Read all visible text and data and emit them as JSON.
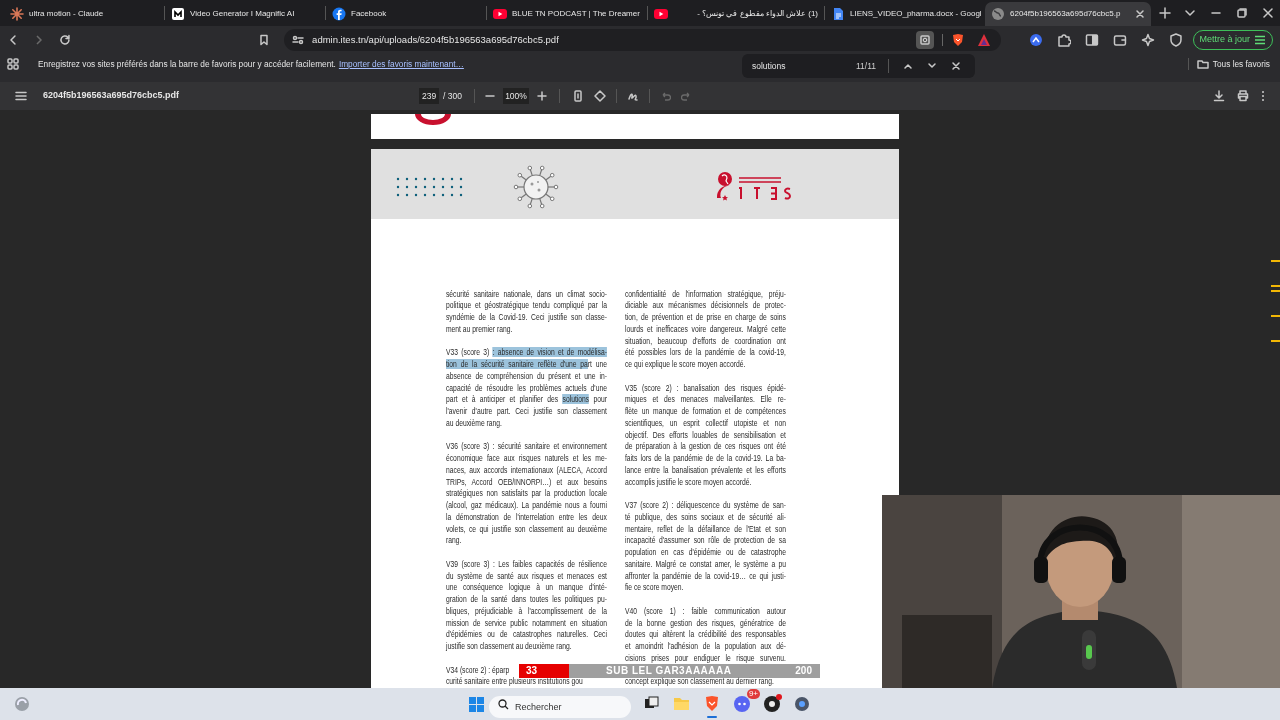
{
  "browser": {
    "tabs": [
      {
        "title": "ultra motion - Claude",
        "selected": false
      },
      {
        "title": "Video Generator I Magnific AI",
        "selected": false
      },
      {
        "title": "Facebook",
        "selected": false
      },
      {
        "title": "BLUE TN PODCAST | The Dreamer",
        "selected": false
      },
      {
        "title": "(1) علاش الدواء مقطوع في تونس؟ -",
        "selected": false
      },
      {
        "title": "LIENS_VIDEO_pharma.docx - Googl",
        "selected": false
      },
      {
        "title": "6204f5b196563a695d76cbc5.p",
        "selected": true
      }
    ],
    "address": "admin.ites.tn/api/uploads/6204f5b196563a695d76cbc5.pdf",
    "update_button": "Mettre à jour",
    "bookmarks_prompt": "Enregistrez vos sites préférés dans la barre de favoris pour y accéder facilement.",
    "bookmarks_link": "Importer des favoris maintenant…",
    "all_bookmarks": "Tous les favoris"
  },
  "find_bar": {
    "query": "solutions",
    "count": "11/11"
  },
  "pdf_viewer": {
    "filename": "6204f5b196563a695d76cbc5.pdf",
    "page": "239",
    "page_total": "/ 300",
    "zoom": "100%",
    "columns": [
      [
        [
          "sécurité sanitaire nationale, dans un climat socio-",
          "politique et géostratégique tendu compliqué par la",
          "syndémie de la Covid-19. Ceci justifie son classe-",
          "ment au premier rang."
        ],
        [
          {
            "segments": [
              {
                "text": "V33 (score 3) ",
                "highlighted": false
              },
              {
                "text": ": absence de vision et de modélisa-",
                "highlighted": true
              }
            ]
          },
          {
            "segments": [
              {
                "text": "tion de la sécurité sanitaire reflète d'une pa",
                "highlighted": true
              },
              {
                "text": "rt une",
                "highlighted": false
              }
            ]
          },
          "absence de compréhension du présent et une in-",
          "capacité de résoudre les problèmes actuels d'une",
          {
            "segments": [
              {
                "text": "part et à anticiper et planifier des ",
                "highlighted": false
              },
              {
                "text": "solutions",
                "highlighted": true
              },
              {
                "text": " pour",
                "highlighted": false
              }
            ]
          },
          "l'avenir d'autre part. Ceci justifie son classement",
          "au deuxième rang."
        ],
        [
          "V36 (score 3) : sécurité sanitaire et environnement",
          "économique face aux risques naturels et les me-",
          "naces, aux accords internationaux (ALECA, Accord",
          "TRIPs, Accord OEB/INNORPI…) et aux besoins",
          "stratégiques non satisfaits par la production locale",
          "(alcool, gaz médicaux). La pandémie nous a fourni",
          "la démonstration de l'interrelation entre les deux",
          "volets, ce qui justifie son classement au deuxième",
          "rang."
        ],
        [
          "V39 (score 3) : Les faibles capacités de résilience",
          "du système de santé aux risques et menaces est",
          "une conséquence logique à un manque d'inté-",
          "gration de la santé dans toutes les politiques pu-",
          "bliques, préjudiciable à l'accomplissement de la",
          "mission de service public notamment en situation",
          "d'épidémies ou de catastrophes naturelles. Ceci",
          "justifie son classement au deuxième rang."
        ],
        [
          "V34 (score 2) : éparp",
          "curité sanitaire entre plusieurs institutions gou"
        ]
      ],
      [
        [
          "confidentialité de l'information stratégique, préju-",
          "diciable aux mécanismes décisionnels de protec-",
          "tion, de prévention et de prise en charge de soins",
          "lourds et inefficaces voire dangereux. Malgré cette",
          "situation, beaucoup d'efforts de coordination ont",
          "été possibles lors de la pandémie de la covid-19,",
          "ce qui explique le score moyen accordé."
        ],
        [
          "V35 (score 2) : banalisation des risques épidé-",
          "miques et des menaces malveillantes. Elle re-",
          "flète un manque de formation et de compétences",
          "scientifiques, un esprit collectif utopiste et non",
          "objectif. Des efforts louables de sensibilisation et",
          "de préparation à la gestion de ces risques ont été",
          "faits lors de la pandémie de de la covid-19. La ba-",
          "lance entre la banalisation prévalente et les efforts",
          "accomplis justifie le score moyen accordé."
        ],
        [
          "V37 (score 2) : déliquescence du système de san-",
          "té publique, des soins sociaux et de sécurité ali-",
          "mentaire, reflet de la défaillance de l'Etat et son",
          "incapacité d'assumer son rôle de protection de sa",
          "population en cas d'épidémie ou de catastrophe",
          "sanitaire. Malgré ce constat amer, le système a pu",
          "affronter la pandémie de la covid-19… ce qui justi-",
          "fie ce score moyen."
        ],
        [
          "V40 (score 1) : faible communication autour",
          "de la bonne gestion des risques, génératrice de",
          "doutes qui altèrent la crédibilité des responsables",
          "et amoindrit l'adhésion de la population aux dé-",
          "cisions prises pour endiguer le risque survenu.",
          null,
          "concept explique son classement au dernier rang."
        ]
      ]
    ]
  },
  "stream_overlay": {
    "count": "33",
    "label": "SUB LEL GAR3AAAAAA",
    "goal": "200",
    "level": 0.165
  },
  "taskbar": {
    "search_placeholder": "Rechercher",
    "badge": "9+"
  }
}
